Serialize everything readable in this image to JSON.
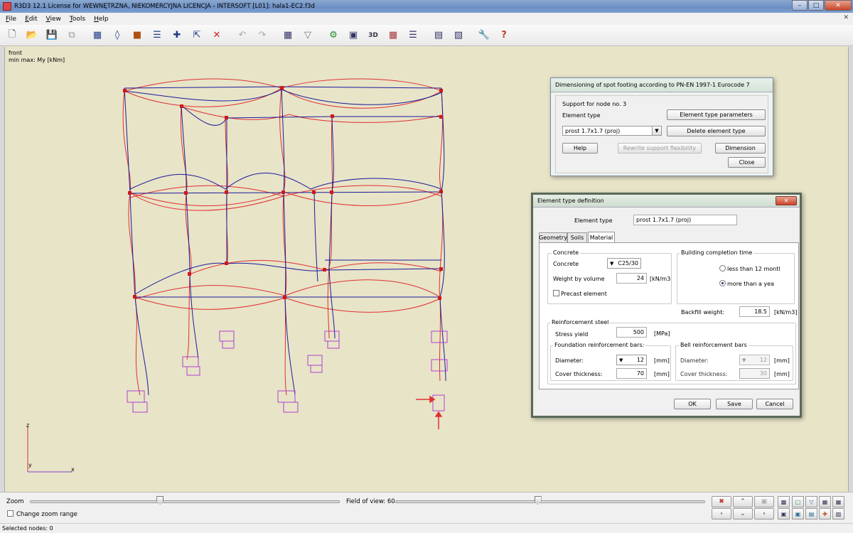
{
  "window": {
    "title": "R3D3 12.1 License for WEWNĘTRZNA, NIEKOMERCYJNA LICENCJA - INTERSOFT [L01]: hala1-EC2.f3d"
  },
  "menu": {
    "items": [
      {
        "first": "F",
        "rest": "ile"
      },
      {
        "first": "E",
        "rest": "dit"
      },
      {
        "first": "V",
        "rest": "iew"
      },
      {
        "first": "T",
        "rest": "ools"
      },
      {
        "first": "H",
        "rest": "elp"
      }
    ]
  },
  "toolbar": {
    "icons": [
      "new-icon",
      "open-icon",
      "save-icon",
      "copy-icon",
      "frame-icon",
      "node-icon",
      "support-icon",
      "bars-icon",
      "measure-icon",
      "select-icon",
      "delete-icon",
      "undo-icon",
      "redo-icon",
      "table-icon",
      "filter-icon",
      "analysis-icon",
      "view-icon",
      "3d-icon",
      "grid-icon",
      "layers-icon",
      "calculator-icon",
      "report-icon",
      "settings-icon",
      "help-icon"
    ]
  },
  "viewport": {
    "view_name": "front",
    "result_label": "min max: My [kNm]",
    "axis_z": "z",
    "axis_y": "y",
    "axis_x": "x"
  },
  "spot_footing_dialog": {
    "title": "Dimensioning of spot footing according to PN-EN 1997-1 Eurocode 7",
    "support_label": "Support for node no. 3",
    "element_type_label": "Element type",
    "element_type_value": "prost 1.7x1.7 (proj)",
    "btn_params": "Element type parameters",
    "btn_delete": "Delete element type",
    "btn_help": "Help",
    "btn_rewrite": "Rewrite support flexibility",
    "btn_dimension": "Dimension",
    "btn_close": "Close"
  },
  "element_type_dialog": {
    "title": "Element type definition",
    "element_type_label": "Element type",
    "element_type_value": "prost 1.7x1.7 (proj)",
    "tabs": [
      "Geometry",
      "Soils",
      "Material"
    ],
    "concrete_group": "Concrete",
    "concrete_label": "Concrete",
    "concrete_value": "C25/30",
    "weight_label": "Weight by volume",
    "weight_value": "24",
    "weight_unit": "[kN/m3",
    "precast_label": "Precast element",
    "completion_group": "Building completion time",
    "radio_less": "less than 12 montl",
    "radio_more": "more than a yea",
    "backfill_label": "Backfill weight:",
    "backfill_value": "18.5",
    "backfill_unit": "[kN/m3]",
    "reinf_group": "Reinforcement steel",
    "stress_label": "Stress yield",
    "stress_value": "500",
    "stress_unit": "[MPa]",
    "found_group": "Foundation reinforcement bars:",
    "diam_label": "Diameter:",
    "diam_value": "12",
    "diam_unit": "[mm]",
    "cover_label": "Cover thickness:",
    "cover_value": "70",
    "cover_unit": "[mm]",
    "bell_group": "Bell reinforcement bars",
    "bell_diam_label": "Diameter:",
    "bell_diam_value": "12",
    "bell_diam_unit": "[mm]",
    "bell_cover_label": "Cover thickness:",
    "bell_cover_value": "30",
    "bell_cover_unit": "[mm]",
    "btn_ok": "OK",
    "btn_save": "Save",
    "btn_cancel": "Cancel"
  },
  "bottom": {
    "zoom_label": "Zoom",
    "fov_label": "Field of view: 60",
    "change_zoom_label": "Change zoom range",
    "zoom_level": 0.42,
    "fov_level": 0.46
  },
  "status": {
    "text": "Selected nodes: 0"
  },
  "colors": {
    "viewport_bg": "#e8e4c8",
    "deformed_red": "#e03030",
    "deformed_blue": "#1a1a9a",
    "support_magenta": "#b040d0",
    "node_red": "#d01818"
  }
}
